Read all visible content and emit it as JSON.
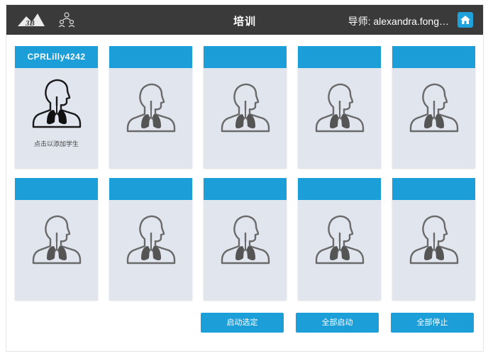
{
  "header": {
    "logo_text": "3B",
    "title": "培训",
    "instructor": "导师: alexandra.fong…",
    "users_icon": "users-group-icon",
    "home_icon": "home-icon"
  },
  "colors": {
    "topbar": "#3a3a3a",
    "accent": "#1c9ed8",
    "card_bg": "#e1e5ee"
  },
  "manikins": [
    {
      "name": "CPRLilly4242",
      "hint": "点击以添加学生",
      "active": true
    },
    {
      "name": "",
      "hint": "",
      "active": false
    },
    {
      "name": "",
      "hint": "",
      "active": false
    },
    {
      "name": "",
      "hint": "",
      "active": false
    },
    {
      "name": "",
      "hint": "",
      "active": false
    },
    {
      "name": "",
      "hint": "",
      "active": false
    },
    {
      "name": "",
      "hint": "",
      "active": false
    },
    {
      "name": "",
      "hint": "",
      "active": false
    },
    {
      "name": "",
      "hint": "",
      "active": false
    },
    {
      "name": "",
      "hint": "",
      "active": false
    }
  ],
  "buttons": {
    "start_selected": "启动选定",
    "start_all": "全部启动",
    "stop_all": "全部停止"
  }
}
